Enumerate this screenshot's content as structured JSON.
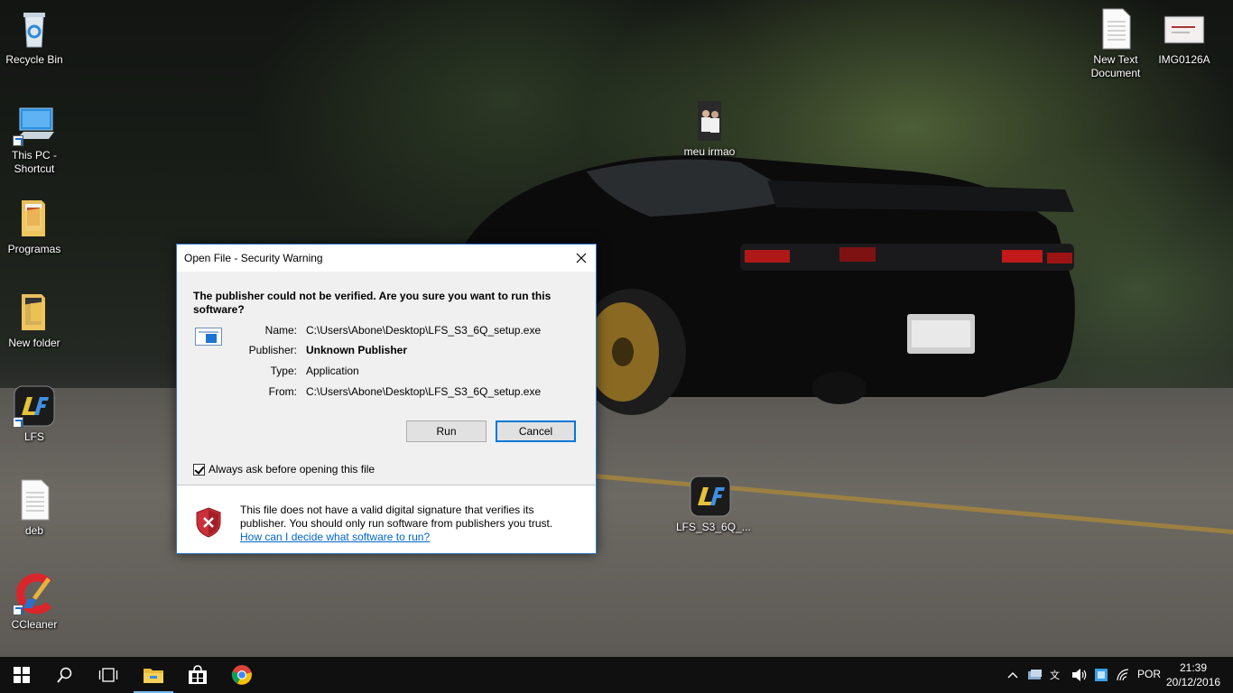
{
  "desktop": {
    "icons_left": [
      {
        "label": "Recycle Bin"
      },
      {
        "label": "This PC - Shortcut"
      },
      {
        "label": "Programas"
      },
      {
        "label": "New folder"
      },
      {
        "label": "LFS"
      },
      {
        "label": "deb"
      },
      {
        "label": "CCleaner"
      }
    ],
    "icons_right": [
      {
        "label": "New Text Document"
      },
      {
        "label": "IMG0126A"
      }
    ],
    "icon_meu_irmao": {
      "label": "meu irmao"
    },
    "icon_lfs_setup": {
      "label": "LFS_S3_6Q_..."
    }
  },
  "dialog": {
    "title": "Open File - Security Warning",
    "heading": "The publisher could not be verified.  Are you sure you want to run this software?",
    "fields": {
      "name_label": "Name:",
      "name_value": "C:\\Users\\Abone\\Desktop\\LFS_S3_6Q_setup.exe",
      "publisher_label": "Publisher:",
      "publisher_value": "Unknown Publisher",
      "type_label": "Type:",
      "type_value": "Application",
      "from_label": "From:",
      "from_value": "C:\\Users\\Abone\\Desktop\\LFS_S3_6Q_setup.exe"
    },
    "run_label": "Run",
    "cancel_label": "Cancel",
    "always_ask_label": "Always ask before opening this file",
    "always_ask_checked": true,
    "warning_text": "This file does not have a valid digital signature that verifies its publisher.  You should only run software from publishers you trust.",
    "help_link": "How can I decide what software to run?"
  },
  "taskbar": {
    "language": "POR",
    "time": "21:39",
    "date": "20/12/2016",
    "accent": "#76b9ed"
  }
}
